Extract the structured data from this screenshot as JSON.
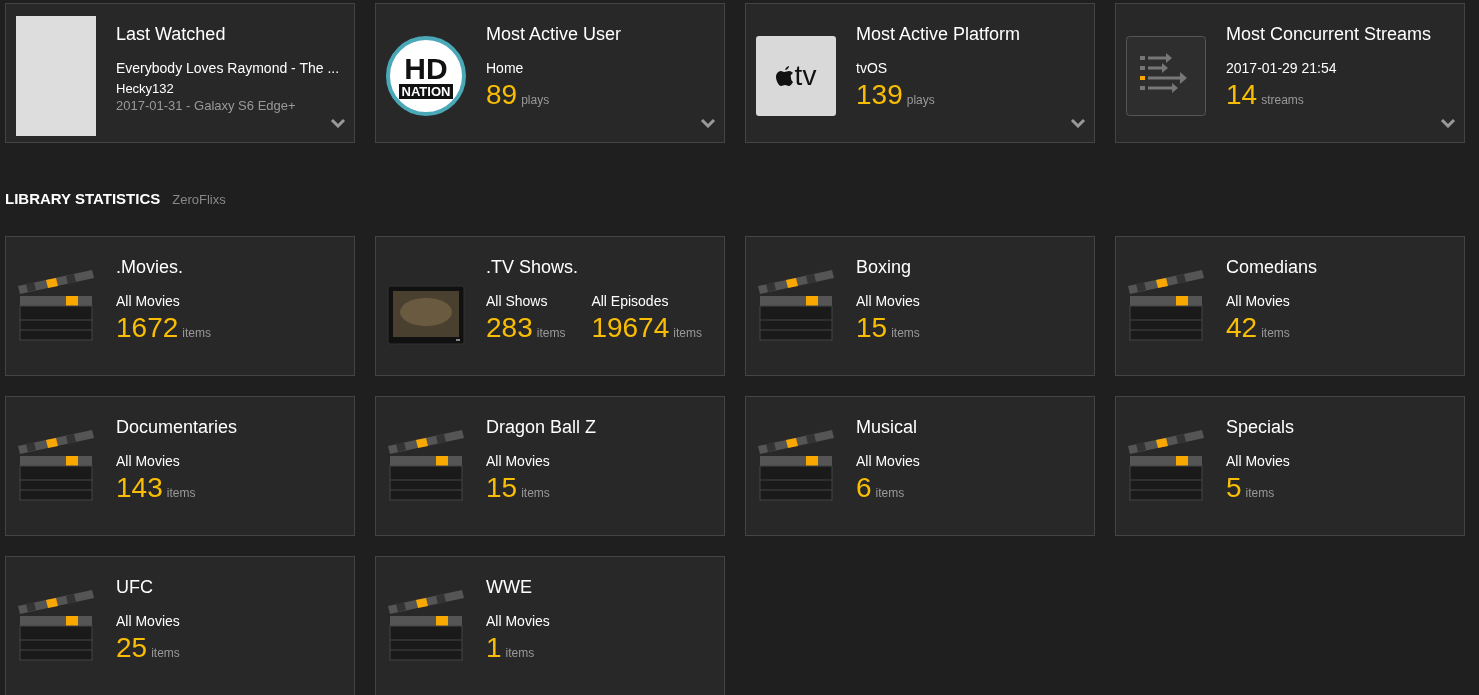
{
  "top_stats": [
    {
      "kind": "poster",
      "title": "Last Watched",
      "subtitle": "Everybody Loves Raymond - The ...",
      "lines": [
        "Hecky132",
        "2017-01-31 - Galaxy S6 Edge+"
      ]
    },
    {
      "kind": "avatar",
      "avatar_text": [
        "HD",
        "NATION"
      ],
      "title": "Most Active User",
      "subtitle": "Home",
      "count": "89",
      "unit": "plays"
    },
    {
      "kind": "platform",
      "logo_text": "tv",
      "title": "Most Active Platform",
      "subtitle": "tvOS",
      "count": "139",
      "unit": "plays"
    },
    {
      "kind": "streams",
      "title": "Most Concurrent Streams",
      "subtitle": "2017-01-29 21:54",
      "count": "14",
      "unit": "streams"
    }
  ],
  "library_statistics": {
    "heading": "LIBRARY STATISTICS",
    "server": "ZeroFlixs",
    "libraries": [
      {
        "kind": "movie",
        "title": ".Movies.",
        "stats": [
          {
            "label": "All Movies",
            "count": "1672",
            "unit": "items"
          }
        ]
      },
      {
        "kind": "show",
        "title": ".TV Shows.",
        "stats": [
          {
            "label": "All Shows",
            "count": "283",
            "unit": "items"
          },
          {
            "label": "All Episodes",
            "count": "19674",
            "unit": "items"
          }
        ]
      },
      {
        "kind": "movie",
        "title": "Boxing",
        "stats": [
          {
            "label": "All Movies",
            "count": "15",
            "unit": "items"
          }
        ]
      },
      {
        "kind": "movie",
        "title": "Comedians",
        "stats": [
          {
            "label": "All Movies",
            "count": "42",
            "unit": "items"
          }
        ]
      },
      {
        "kind": "movie",
        "title": "Documentaries",
        "stats": [
          {
            "label": "All Movies",
            "count": "143",
            "unit": "items"
          }
        ]
      },
      {
        "kind": "movie",
        "title": "Dragon Ball Z",
        "stats": [
          {
            "label": "All Movies",
            "count": "15",
            "unit": "items"
          }
        ]
      },
      {
        "kind": "movie",
        "title": "Musical",
        "stats": [
          {
            "label": "All Movies",
            "count": "6",
            "unit": "items"
          }
        ]
      },
      {
        "kind": "movie",
        "title": "Specials",
        "stats": [
          {
            "label": "All Movies",
            "count": "5",
            "unit": "items"
          }
        ]
      },
      {
        "kind": "movie",
        "title": "UFC",
        "stats": [
          {
            "label": "All Movies",
            "count": "25",
            "unit": "items"
          }
        ]
      },
      {
        "kind": "movie",
        "title": "WWE",
        "stats": [
          {
            "label": "All Movies",
            "count": "1",
            "unit": "items"
          }
        ]
      }
    ]
  }
}
